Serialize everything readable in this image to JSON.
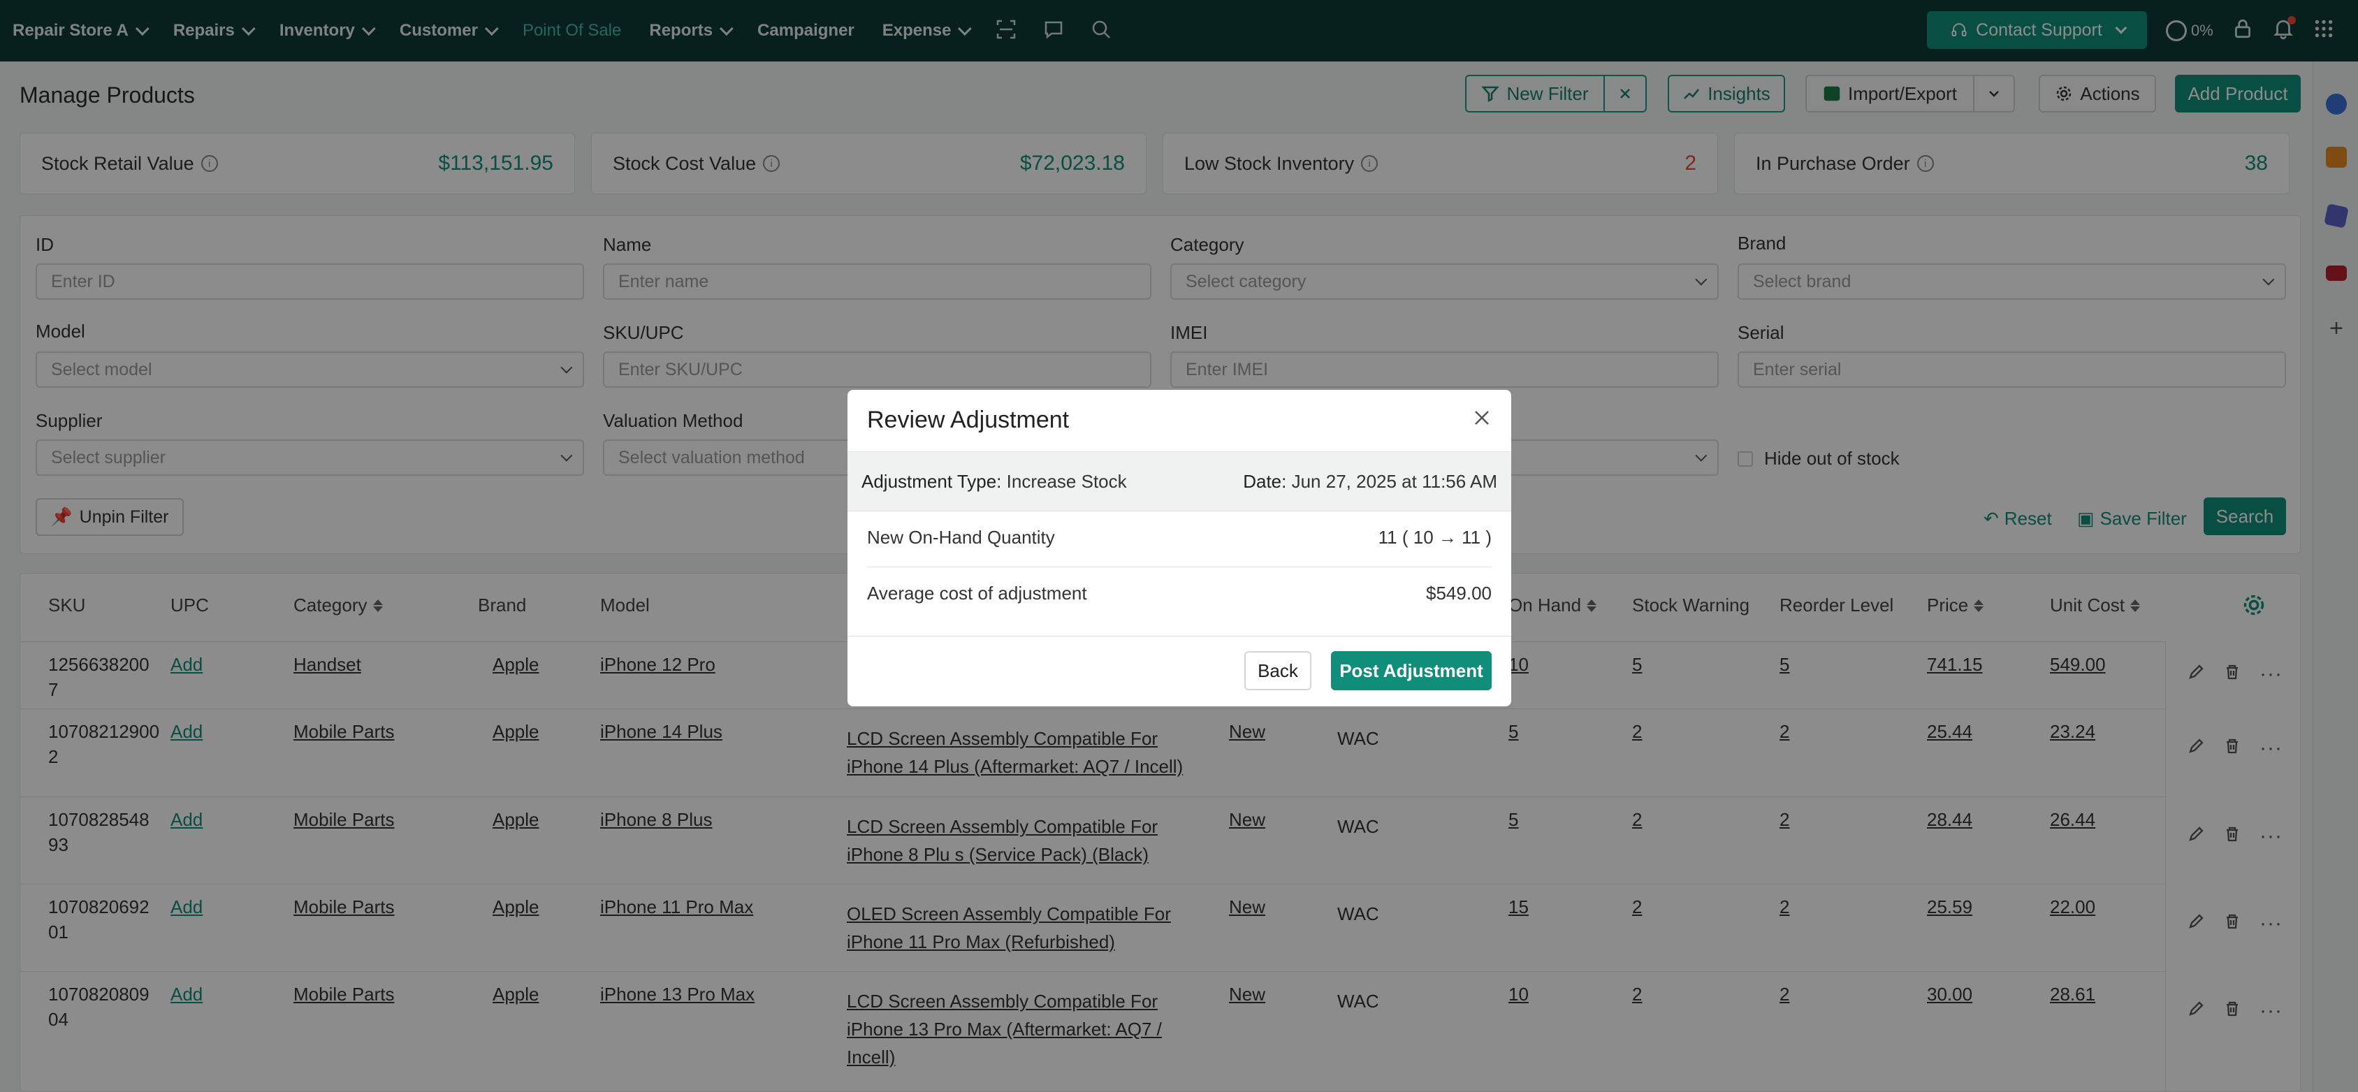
{
  "nav": {
    "items": [
      {
        "label": "Repair Store A",
        "chevron": true
      },
      {
        "label": "Repairs",
        "chevron": true
      },
      {
        "label": "Inventory",
        "chevron": true
      },
      {
        "label": "Customer",
        "chevron": true
      },
      {
        "label": "Point Of Sale",
        "chevron": false,
        "active": true
      },
      {
        "label": "Reports",
        "chevron": true
      },
      {
        "label": "Campaigner",
        "chevron": false
      },
      {
        "label": "Expense",
        "chevron": true
      }
    ],
    "support_label": "Contact Support",
    "progress_text": "0%",
    "colors": {
      "bar": "#0e3b36",
      "accent": "#118e79",
      "active": "#3fbfa4"
    }
  },
  "page": {
    "title": "Manage Products",
    "toolbar": {
      "new_filter": "New Filter",
      "insights": "Insights",
      "import_export": "Import/Export",
      "actions": "Actions",
      "add_product": "Add Product"
    }
  },
  "stats": [
    {
      "label": "Stock Retail Value",
      "value": "$113,151.95",
      "color": "#118e79"
    },
    {
      "label": "Stock Cost Value",
      "value": "$72,023.18",
      "color": "#118e79"
    },
    {
      "label": "Low Stock Inventory",
      "value": "2",
      "color": "#e74c3c"
    },
    {
      "label": "In Purchase Order",
      "value": "38",
      "color": "#118e79"
    }
  ],
  "filters": {
    "id": {
      "label": "ID",
      "placeholder": "Enter ID"
    },
    "name": {
      "label": "Name",
      "placeholder": "Enter name"
    },
    "category": {
      "label": "Category",
      "placeholder": "Select category"
    },
    "brand": {
      "label": "Brand",
      "placeholder": "Select brand"
    },
    "model": {
      "label": "Model",
      "placeholder": "Select model"
    },
    "sku": {
      "label": "SKU/UPC",
      "placeholder": "Enter SKU/UPC"
    },
    "imei": {
      "label": "IMEI",
      "placeholder": "Enter IMEI"
    },
    "serial": {
      "label": "Serial",
      "placeholder": "Enter serial"
    },
    "supplier": {
      "label": "Supplier",
      "placeholder": "Select supplier"
    },
    "valuation": {
      "label": "Valuation Method",
      "placeholder": "Select valuation method"
    },
    "hide_oos": "Hide out of stock",
    "unpin": "Unpin Filter",
    "reset": "Reset",
    "save_filter": "Save Filter",
    "search": "Search"
  },
  "table": {
    "headers": {
      "sku": "SKU",
      "upc": "UPC",
      "category": "Category",
      "brand": "Brand",
      "model": "Model",
      "on_hand": "On Hand",
      "stock_warning": "Stock Warning",
      "reorder": "Reorder Level",
      "price": "Price",
      "unit_cost": "Unit Cost"
    },
    "rows": [
      {
        "sku1": "1256638200",
        "sku2": "7",
        "upc": "Add",
        "category": "Handset",
        "brand": "Apple",
        "model": "iPhone 12 Pro",
        "name1": "",
        "name2": "",
        "condition": "",
        "valuation": "",
        "on_hand": "10",
        "warning": "5",
        "reorder": "5",
        "price": "741.15",
        "cost": "549.00"
      },
      {
        "sku1": "10708212900",
        "sku2": "2",
        "upc": "Add",
        "category": "Mobile Parts",
        "brand": "Apple",
        "model": "iPhone 14 Plus",
        "name1": "LCD Screen Assembly Compatible For",
        "name2": "iPhone 14 Plus (Aftermarket: AQ7 / Incell)",
        "condition": "New",
        "valuation": "WAC",
        "on_hand": "5",
        "warning": "2",
        "reorder": "2",
        "price": "25.44",
        "cost": "23.24"
      },
      {
        "sku1": "1070828548",
        "sku2": "93",
        "upc": "Add",
        "category": "Mobile Parts",
        "brand": "Apple",
        "model": "iPhone 8 Plus",
        "name1": "LCD Screen Assembly Compatible For",
        "name2": "iPhone 8 Plu s (Service Pack) (Black)",
        "condition": "New",
        "valuation": "WAC",
        "on_hand": "5",
        "warning": "2",
        "reorder": "2",
        "price": "28.44",
        "cost": "26.44"
      },
      {
        "sku1": "1070820692",
        "sku2": "01",
        "upc": "Add",
        "category": "Mobile Parts",
        "brand": "Apple",
        "model": "iPhone 11 Pro Max",
        "name1": "OLED Screen Assembly Compatible For",
        "name2": "iPhone 11 Pro Max (Refurbished)",
        "condition": "New",
        "valuation": "WAC",
        "on_hand": "15",
        "warning": "2",
        "reorder": "2",
        "price": "25.59",
        "cost": "22.00"
      },
      {
        "sku1": "1070820809",
        "sku2": "04",
        "upc": "Add",
        "category": "Mobile Parts",
        "brand": "Apple",
        "model": "iPhone 13 Pro Max",
        "name1": "LCD Screen Assembly Compatible For",
        "name2": "iPhone 13 Pro Max (Aftermarket: AQ7 /",
        "name3": "Incell)",
        "condition": "New",
        "valuation": "WAC",
        "on_hand": "10",
        "warning": "2",
        "reorder": "2",
        "price": "30.00",
        "cost": "28.61"
      }
    ]
  },
  "modal": {
    "title": "Review Adjustment",
    "adj_type_label": "Adjustment Type:",
    "adj_type_value": "Increase Stock",
    "date_label": "Date:",
    "date_value": "Jun 27, 2025 at 11:56 AM",
    "qty_label": "New On-Hand Quantity",
    "qty_value": "11 ( 10 → 11 )",
    "avg_label": "Average cost of adjustment",
    "avg_value": "$549.00",
    "back": "Back",
    "post": "Post Adjustment"
  }
}
